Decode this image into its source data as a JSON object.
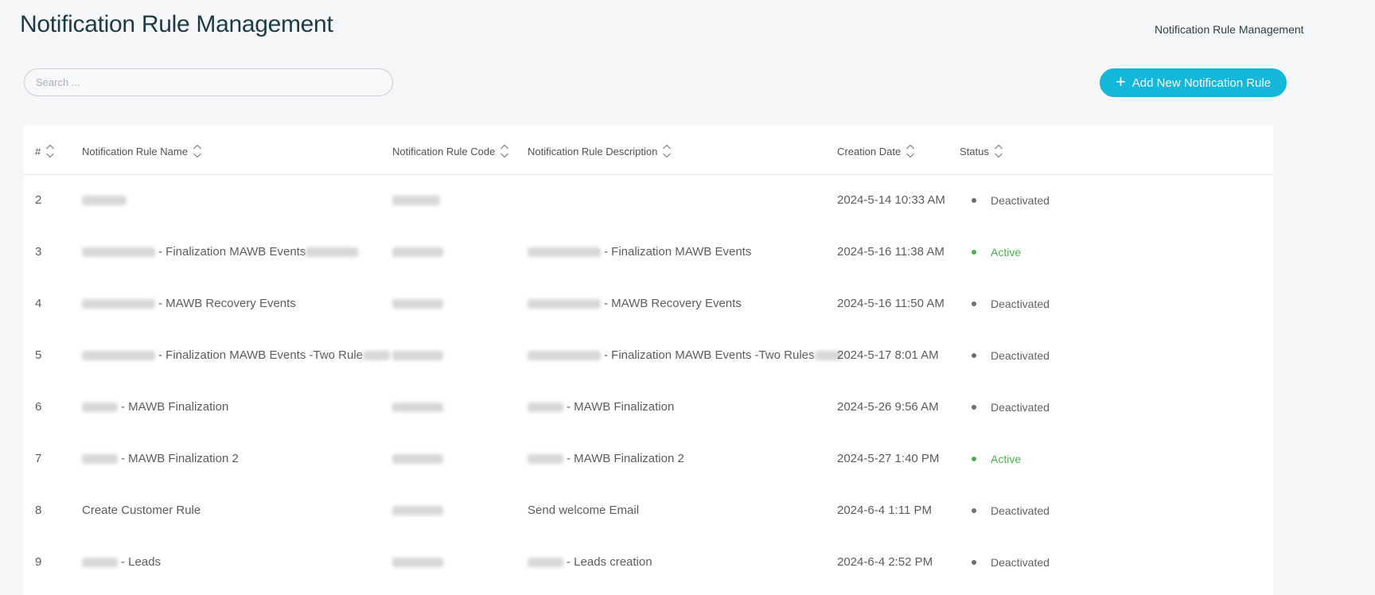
{
  "header": {
    "title": "Notification Rule Management",
    "breadcrumb": "Notification Rule Management"
  },
  "search": {
    "placeholder": "Search ...",
    "value": ""
  },
  "add_button": {
    "label": "Add New Notification Rule",
    "icon": "plus-icon"
  },
  "table": {
    "columns": [
      "#",
      "Notification Rule Name",
      "Notification Rule Code",
      "Notification Rule Description",
      "Creation Date",
      "Status"
    ],
    "rows": [
      {
        "num": "2",
        "name": "",
        "code": "",
        "description": "",
        "date": "2024-5-14 10:33 AM",
        "status": "Deactivated"
      },
      {
        "num": "3",
        "name": "- Finalization MAWB Events",
        "code": "",
        "description": "- Finalization MAWB Events",
        "date": "2024-5-16 11:38 AM",
        "status": "Active"
      },
      {
        "num": "4",
        "name": "- MAWB Recovery Events",
        "code": "",
        "description": "- MAWB Recovery Events",
        "date": "2024-5-16 11:50 AM",
        "status": "Deactivated"
      },
      {
        "num": "5",
        "name": "- Finalization MAWB Events -Two Rule",
        "code": "",
        "description": "- Finalization MAWB Events -Two Rules",
        "date": "2024-5-17 8:01 AM",
        "status": "Deactivated"
      },
      {
        "num": "6",
        "name": "- MAWB Finalization",
        "code": "",
        "description": "- MAWB Finalization",
        "date": "2024-5-26 9:56 AM",
        "status": "Deactivated"
      },
      {
        "num": "7",
        "name": "- MAWB Finalization 2",
        "code": "",
        "description": "- MAWB Finalization 2",
        "date": "2024-5-27 1:40 PM",
        "status": "Active"
      },
      {
        "num": "8",
        "name": "Create Customer Rule",
        "code": "",
        "description": "Send welcome Email",
        "date": "2024-6-4 1:11 PM",
        "status": "Deactivated"
      },
      {
        "num": "9",
        "name": "- Leads",
        "code": "",
        "description": "- Leads creation",
        "date": "2024-6-4 2:52 PM",
        "status": "Deactivated"
      }
    ]
  },
  "colors": {
    "accent": "#12b7dc",
    "title": "#1d3b47",
    "active": "#4cae4f",
    "deactivated": "#5f6366",
    "active_dot": "#4cae4f",
    "deactivated_dot": "#6b6e71"
  }
}
